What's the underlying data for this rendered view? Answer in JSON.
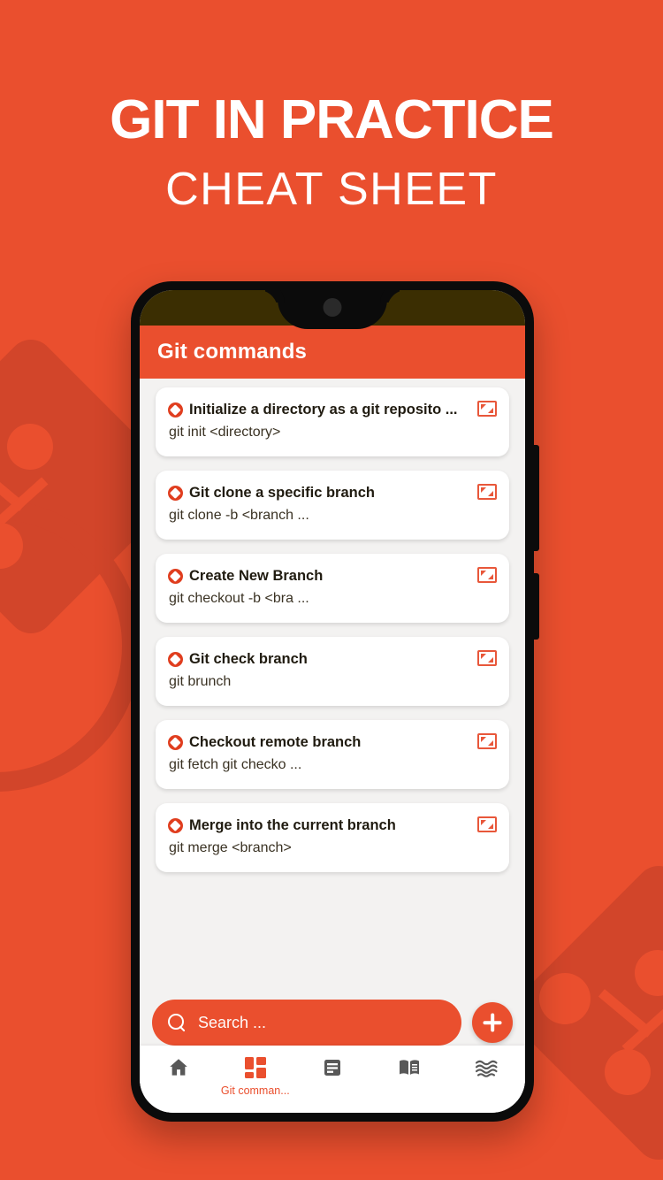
{
  "poster": {
    "background_color": "#EA4F2E",
    "deco_color": "#D2452A",
    "headline_main": "GIT IN PRACTICE",
    "headline_sub": "CHEAT SHEET"
  },
  "phone": {
    "status_bar_color": "#3B2E02",
    "frame_color": "#0B0B0B"
  },
  "app": {
    "accent_color": "#EA4F2E",
    "app_bar": {
      "title": "Git commands"
    },
    "commands": [
      {
        "title": "Initialize a directory as a git reposito ...",
        "command": "git init <directory>",
        "bullet_icon": "git-diamond-icon",
        "action_icon": "expand-icon"
      },
      {
        "title": "Git clone a specific branch",
        "command": "git clone -b <branch ...",
        "bullet_icon": "git-diamond-icon",
        "action_icon": "expand-icon"
      },
      {
        "title": "Create New Branch",
        "command": "git checkout -b <bra ...",
        "bullet_icon": "git-diamond-icon",
        "action_icon": "expand-icon"
      },
      {
        "title": "Git check branch",
        "command": "git brunch",
        "bullet_icon": "git-diamond-icon",
        "action_icon": "expand-icon"
      },
      {
        "title": "Checkout remote branch",
        "command": "git fetch git checko ...",
        "bullet_icon": "git-diamond-icon",
        "action_icon": "expand-icon"
      },
      {
        "title": "Merge into the current branch",
        "command": "git merge <branch>",
        "bullet_icon": "git-diamond-icon",
        "action_icon": "expand-icon"
      }
    ],
    "search": {
      "placeholder": "Search ...",
      "value": "",
      "icon": "search-icon"
    },
    "fab": {
      "icon": "plus-icon",
      "label": "Add"
    },
    "bottom_nav": {
      "active_index": 1,
      "items": [
        {
          "icon": "home-icon",
          "label": ""
        },
        {
          "icon": "dashboard-grid-icon",
          "label": "Git comman..."
        },
        {
          "icon": "article-icon",
          "label": ""
        },
        {
          "icon": "book-icon",
          "label": ""
        },
        {
          "icon": "waves-icon",
          "label": ""
        }
      ]
    }
  }
}
